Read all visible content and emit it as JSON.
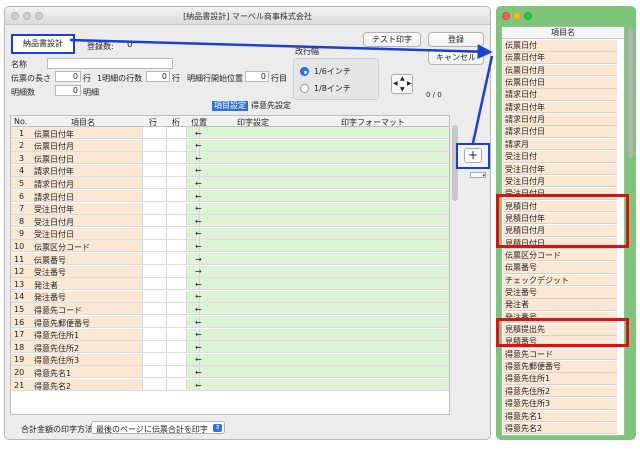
{
  "window": {
    "title": "[納品書設計] マーベル商事株式会社"
  },
  "header": {
    "tab_label": "納品書設計",
    "count_label": "登録数:",
    "count_value": "0",
    "name_label": "名称",
    "slip_length_label": "伝票の長さ",
    "slip_length_value": "0",
    "slip_length_unit": "行",
    "lines_per_detail_label": "1明細の行数",
    "lines_per_detail_value": "0",
    "lines_per_detail_unit": "行",
    "detail_start_label": "明細行開始位置",
    "detail_start_value": "0",
    "detail_start_unit": "行目",
    "detail_count_label": "明細数",
    "detail_count_value": "0",
    "detail_count_unit": "明細"
  },
  "line_feed": {
    "label": "改行幅",
    "options": [
      "1/6インチ",
      "1/8インチ"
    ],
    "selected": "1/6インチ"
  },
  "page_indicator": "0  /  0",
  "buttons": {
    "test_print": "テスト印字",
    "register": "登録",
    "cancel": "キャンセル",
    "add": "+"
  },
  "segments": {
    "item_settings": "項目設定",
    "customer_settings": "得意先設定"
  },
  "table": {
    "headers": {
      "no": "No.",
      "item": "項目名",
      "row": "行",
      "col": "桁",
      "position": "位置",
      "print_setting": "印字設定",
      "print_format": "印字フォーマット"
    },
    "rows": [
      {
        "no": "1",
        "name": "伝票日付年",
        "pos": "←"
      },
      {
        "no": "2",
        "name": "伝票日付月",
        "pos": "←"
      },
      {
        "no": "3",
        "name": "伝票日付日",
        "pos": "←"
      },
      {
        "no": "4",
        "name": "請求日付年",
        "pos": "←"
      },
      {
        "no": "5",
        "name": "請求日付月",
        "pos": "←"
      },
      {
        "no": "6",
        "name": "請求日付日",
        "pos": "←"
      },
      {
        "no": "7",
        "name": "受注日付年",
        "pos": "←"
      },
      {
        "no": "8",
        "name": "受注日付月",
        "pos": "←"
      },
      {
        "no": "9",
        "name": "受注日付日",
        "pos": "←"
      },
      {
        "no": "10",
        "name": "伝票区分コード",
        "pos": "←"
      },
      {
        "no": "11",
        "name": "伝票番号",
        "pos": "→"
      },
      {
        "no": "12",
        "name": "受注番号",
        "pos": "→"
      },
      {
        "no": "13",
        "name": "発注者",
        "pos": "←"
      },
      {
        "no": "14",
        "name": "発注番号",
        "pos": "←"
      },
      {
        "no": "15",
        "name": "得意先コード",
        "pos": "←"
      },
      {
        "no": "16",
        "name": "得意先郵便番号",
        "pos": "←"
      },
      {
        "no": "17",
        "name": "得意先住所1",
        "pos": "←"
      },
      {
        "no": "18",
        "name": "得意先住所2",
        "pos": "←"
      },
      {
        "no": "19",
        "name": "得意先住所3",
        "pos": "←"
      },
      {
        "no": "20",
        "name": "得意先名1",
        "pos": "←"
      },
      {
        "no": "21",
        "name": "得意先名2",
        "pos": "←"
      }
    ]
  },
  "footer": {
    "total_method_label": "合計金額の印字方法",
    "total_method_value": "最後のページに伝票合計を印字"
  },
  "item_list": {
    "header": "項目名",
    "items": [
      "伝票日付",
      "伝票日付年",
      "伝票日付月",
      "伝票日付日",
      "請求日付",
      "請求日付年",
      "請求日付月",
      "請求日付日",
      "請求月",
      "受注日付",
      "受注日付年",
      "受注日付月",
      "受注日付日",
      "見積日付",
      "見積日付年",
      "見積日付月",
      "見積日付日",
      "伝票区分コード",
      "伝票番号",
      "チェックデジット",
      "受注番号",
      "発注者",
      "発注番号",
      "見積提出先",
      "見積番号",
      "得意先コード",
      "得意先郵便番号",
      "得意先住所1",
      "得意先住所2",
      "得意先住所3",
      "得意先名1",
      "得意先名2"
    ]
  },
  "colors": {
    "highlight_blue": "#1a3fd6",
    "highlight_red": "#e01010",
    "side_window_bg": "#7ec47a",
    "row_name_bg": "#fbe8d4",
    "row_green_bg": "#ddf3d6"
  }
}
